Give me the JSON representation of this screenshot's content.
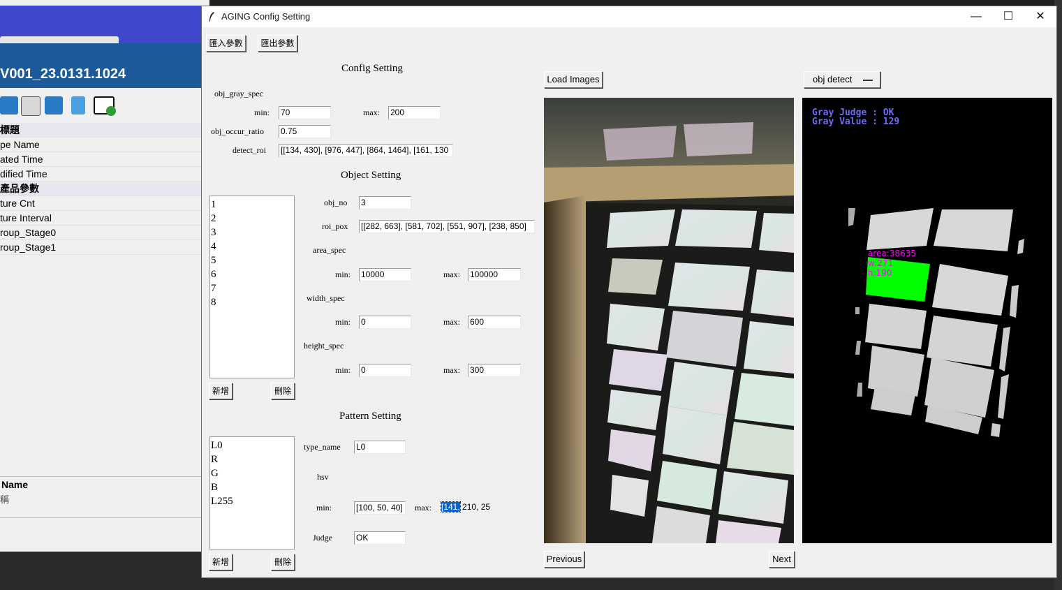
{
  "background_app": {
    "version_title": "V001_23.0131.1024",
    "properties": [
      {
        "label": "標題",
        "category": true
      },
      {
        "label": "pe Name",
        "category": false
      },
      {
        "label": "ated Time",
        "category": false
      },
      {
        "label": "dified Time",
        "category": false
      },
      {
        "label": "產品參數",
        "category": true
      },
      {
        "label": "ture Cnt",
        "category": false
      },
      {
        "label": "ture Interval",
        "category": false
      },
      {
        "label": "roup_Stage0",
        "category": false
      },
      {
        "label": "roup_Stage1",
        "category": false
      }
    ],
    "bottom_name_label": "Name",
    "bottom_name_value": "稱"
  },
  "dialog": {
    "title": "AGING Config Setting",
    "import_button": "匯入參數",
    "export_button": "匯出參數",
    "config_header": "Config Setting",
    "obj_gray_spec_label": "obj_gray_spec",
    "min_label": "min:",
    "max_label": "max:",
    "gray_min": "70",
    "gray_max": "200",
    "obj_occur_ratio_label": "obj_occur_ratio",
    "obj_occur_ratio": "0.75",
    "detect_roi_label": "detect_roi",
    "detect_roi": "[[134, 430], [976, 447], [864, 1464], [161, 130",
    "object_header": "Object Setting",
    "object_list": [
      "1",
      "2",
      "3",
      "4",
      "5",
      "6",
      "7",
      "8"
    ],
    "obj_no_label": "obj_no",
    "obj_no": "3",
    "roi_pox_label": "roi_pox",
    "roi_pox": "[[282, 663], [581, 702], [551, 907], [238, 850]",
    "area_spec_label": "area_spec",
    "area_min": "10000",
    "area_max": "100000",
    "width_spec_label": "width_spec",
    "width_min": "0",
    "width_max": "600",
    "height_spec_label": "height_spec",
    "height_min": "0",
    "height_max": "300",
    "add_button": "新增",
    "delete_button": "刪除",
    "pattern_header": "Pattern Setting",
    "pattern_list": [
      "L0",
      "R",
      "G",
      "B",
      "L255"
    ],
    "type_name_label": "type_name",
    "type_name": "L0",
    "hsv_label": "hsv",
    "hsv_min": "[100, 50, 40]",
    "hsv_max_selected": "[141,",
    "hsv_max_rest": " 210, 25",
    "judge_label": "Judge",
    "judge": "OK",
    "load_images_button": "Load Images",
    "mode_select": "obj detect",
    "previous_button": "Previous",
    "next_button": "Next",
    "overlay": {
      "gray_judge": "Gray Judge : OK",
      "gray_value": "Gray Value : 129",
      "area": "area:38635",
      "w": "w:271",
      "h": "h:190"
    }
  },
  "colors": {
    "accent_blue": "#3f48cc",
    "detect_green": "#00ff00",
    "overlay_text": "#6b6bff",
    "annotation_magenta": "#ff00ff"
  }
}
